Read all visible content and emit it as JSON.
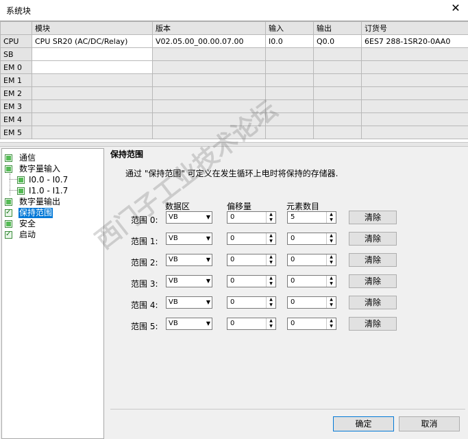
{
  "window": {
    "title": "系统块",
    "close_glyph": "✕"
  },
  "grid": {
    "headers": [
      "",
      "模块",
      "版本",
      "输入",
      "输出",
      "订货号"
    ],
    "rows": [
      {
        "name": "CPU",
        "module": "CPU SR20 (AC/DC/Relay)",
        "version": "V02.05.00_00.00.07.00",
        "input": "I0.0",
        "output": "Q0.0",
        "order": "6ES7 288-1SR20-0AA0"
      },
      {
        "name": "SB",
        "module": "",
        "version": "",
        "input": "",
        "output": "",
        "order": ""
      },
      {
        "name": "EM 0",
        "module": "",
        "version": "",
        "input": "",
        "output": "",
        "order": ""
      },
      {
        "name": "EM 1",
        "module": "",
        "version": "",
        "input": "",
        "output": "",
        "order": ""
      },
      {
        "name": "EM 2",
        "module": "",
        "version": "",
        "input": "",
        "output": "",
        "order": ""
      },
      {
        "name": "EM 3",
        "module": "",
        "version": "",
        "input": "",
        "output": "",
        "order": ""
      },
      {
        "name": "EM 4",
        "module": "",
        "version": "",
        "input": "",
        "output": "",
        "order": ""
      },
      {
        "name": "EM 5",
        "module": "",
        "version": "",
        "input": "",
        "output": "",
        "order": ""
      }
    ]
  },
  "tree": {
    "items": [
      {
        "label": "通信",
        "state": "square"
      },
      {
        "label": "数字量输入",
        "state": "square"
      },
      {
        "label": "I0.0 - I0.7",
        "state": "square"
      },
      {
        "label": "I1.0 - I1.7",
        "state": "square"
      },
      {
        "label": "数字量输出",
        "state": "square"
      },
      {
        "label": "保持范围",
        "state": "checked",
        "selected": true
      },
      {
        "label": "安全",
        "state": "square"
      },
      {
        "label": "启动",
        "state": "checked"
      }
    ]
  },
  "panel": {
    "title": "保持范围",
    "description": "通过 \"保持范围\" 可定义在发生循环上电时将保持的存储器.",
    "col_area": "数据区",
    "col_offset": "偏移量",
    "col_count": "元素数目",
    "clear_label": "清除",
    "ranges": [
      {
        "label": "范围 0:",
        "area": "VB",
        "offset": "0",
        "count": "5"
      },
      {
        "label": "范围 1:",
        "area": "VB",
        "offset": "0",
        "count": "0"
      },
      {
        "label": "范围 2:",
        "area": "VB",
        "offset": "0",
        "count": "0"
      },
      {
        "label": "范围 3:",
        "area": "VB",
        "offset": "0",
        "count": "0"
      },
      {
        "label": "范围 4:",
        "area": "VB",
        "offset": "0",
        "count": "0"
      },
      {
        "label": "范围 5:",
        "area": "VB",
        "offset": "0",
        "count": "0"
      }
    ]
  },
  "footer": {
    "ok_label": "确定",
    "cancel_label": "取消"
  },
  "watermark": {
    "text": "西门子工业技术论坛"
  },
  "colors": {
    "selection": "#0078d7",
    "checkbox_green": "#55bb55"
  }
}
